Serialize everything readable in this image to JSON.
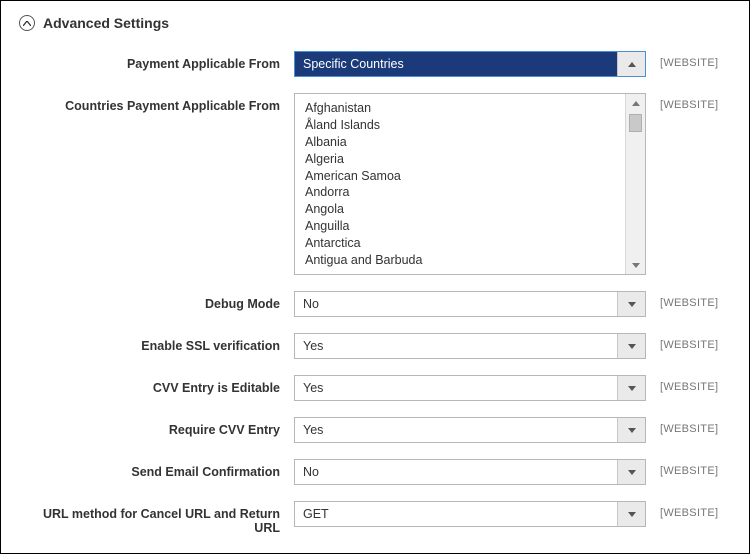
{
  "section": {
    "title": "Advanced Settings"
  },
  "scope_label": "[WEBSITE]",
  "fields": {
    "payment_applicable_from": {
      "label": "Payment Applicable From",
      "value": "Specific Countries"
    },
    "countries": {
      "label": "Countries Payment Applicable From",
      "options": [
        "Afghanistan",
        "Åland Islands",
        "Albania",
        "Algeria",
        "American Samoa",
        "Andorra",
        "Angola",
        "Anguilla",
        "Antarctica",
        "Antigua and Barbuda"
      ]
    },
    "debug_mode": {
      "label": "Debug Mode",
      "value": "No"
    },
    "enable_ssl": {
      "label": "Enable SSL verification",
      "value": "Yes"
    },
    "cvv_editable": {
      "label": "CVV Entry is Editable",
      "value": "Yes"
    },
    "require_cvv": {
      "label": "Require CVV Entry",
      "value": "Yes"
    },
    "send_email": {
      "label": "Send Email Confirmation",
      "value": "No"
    },
    "url_method": {
      "label": "URL method for Cancel URL and Return URL",
      "value": "GET"
    }
  }
}
